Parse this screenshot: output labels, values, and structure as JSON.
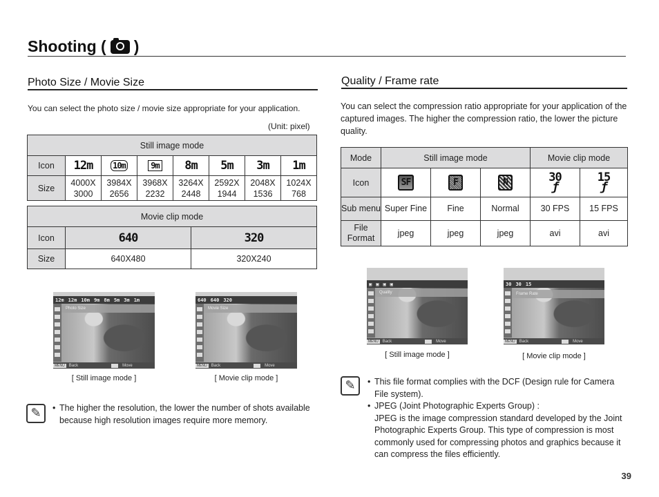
{
  "page": {
    "title": "Shooting (",
    "title_close": ")",
    "title_icon": "camera-icon",
    "page_number": "39"
  },
  "left": {
    "section_title": "Photo Size / Movie Size",
    "intro": "You can select the photo size / movie size appropriate for your application.",
    "unit": "(Unit: pixel)",
    "still_table": {
      "header": "Still image mode",
      "row_labels": [
        "Icon",
        "Size"
      ],
      "columns": [
        {
          "icon": "12m",
          "size1": "4000X",
          "size2": "3000"
        },
        {
          "icon": "10m",
          "size1": "3984X",
          "size2": "2656"
        },
        {
          "icon": "9m",
          "size1": "3968X",
          "size2": "2232"
        },
        {
          "icon": "8m",
          "size1": "3264X",
          "size2": "2448"
        },
        {
          "icon": "5m",
          "size1": "2592X",
          "size2": "1944"
        },
        {
          "icon": "3m",
          "size1": "2048X",
          "size2": "1536"
        },
        {
          "icon": "1m",
          "size1": "1024X",
          "size2": "768"
        }
      ]
    },
    "movie_table": {
      "header": "Movie clip mode",
      "row_labels": [
        "Icon",
        "Size"
      ],
      "columns": [
        {
          "icon": "640",
          "size": "640X480"
        },
        {
          "icon": "320",
          "size": "320X240"
        }
      ]
    },
    "screens": [
      {
        "options": [
          "12m",
          "12m",
          "10m",
          "9m",
          "8m",
          "5m",
          "3m",
          "1m"
        ],
        "label": "Photo Size",
        "back": "Back",
        "move": "Move",
        "caption": "[ Still image mode ]"
      },
      {
        "options": [
          "640",
          "640",
          "320"
        ],
        "label": "Movie Size",
        "back": "Back",
        "move": "Move",
        "caption": "[ Movie clip mode ]"
      }
    ],
    "note": "The higher the resolution, the lower the number of shots available because high resolution images require more memory."
  },
  "right": {
    "section_title": "Quality / Frame rate",
    "intro": "You can select the compression ratio appropriate for your application of the captured images. The higher the compression ratio, the lower the picture quality.",
    "table": {
      "mode_label": "Mode",
      "still_header": "Still image mode",
      "movie_header": "Movie clip mode",
      "row_labels": [
        "Icon",
        "Sub menu",
        "File Format"
      ],
      "columns": [
        {
          "icon": "SF",
          "sub": "Super Fine",
          "format": "jpeg"
        },
        {
          "icon": "F",
          "sub": "Fine",
          "format": "jpeg"
        },
        {
          "icon": "N",
          "sub": "Normal",
          "format": "jpeg"
        },
        {
          "icon": "30",
          "sub": "30 FPS",
          "format": "avi"
        },
        {
          "icon": "15",
          "sub": "15 FPS",
          "format": "avi"
        }
      ]
    },
    "screens": [
      {
        "label": "Quality",
        "back": "Back",
        "move": "Move",
        "caption": "[ Still image mode ]"
      },
      {
        "label": "Frame Rate",
        "back": "Back",
        "move": "Move",
        "caption": "[ Movie clip mode ]"
      }
    ],
    "notes": [
      "This file format complies with the DCF (Design rule for Camera File system).",
      "JPEG (Joint Photographic Experts Group) :"
    ],
    "jpeg_desc": "JPEG is the image compression standard developed by the Joint Photographic Experts Group. This type of compression is most commonly used for compressing photos and graphics because it can compress the files efficiently."
  }
}
